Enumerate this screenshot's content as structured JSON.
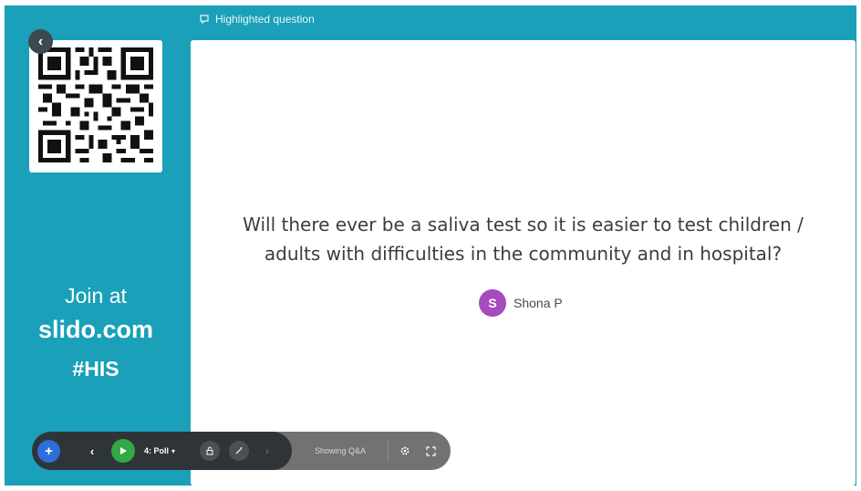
{
  "header": {
    "label": "Highlighted question"
  },
  "sidebar": {
    "back_icon": "chevron-left-icon",
    "join_line1": "Join at",
    "join_url": "slido.com",
    "event_code": "#HIS"
  },
  "question": {
    "line1": "Will there ever be a saliva test so it is easier to test children /",
    "line2": "adults with difficulties in the community and in hospital?",
    "author_initial": "S",
    "author_name": "Shona P"
  },
  "toolbar": {
    "add_icon": "plus-icon",
    "prev_icon": "chevron-left-icon",
    "play_icon": "play-icon",
    "poll_label": "4: Poll",
    "lock_icon": "lock-icon",
    "wand_icon": "magic-wand-icon",
    "next_icon": "chevron-right-icon",
    "status": "Showing Q&A",
    "settings_icon": "gear-icon",
    "fullscreen_icon": "fullscreen-icon"
  },
  "colors": {
    "background_teal": "#1aa0b8",
    "avatar_purple": "#a64bbf",
    "play_green": "#33a846",
    "add_blue": "#2e6ed8"
  }
}
